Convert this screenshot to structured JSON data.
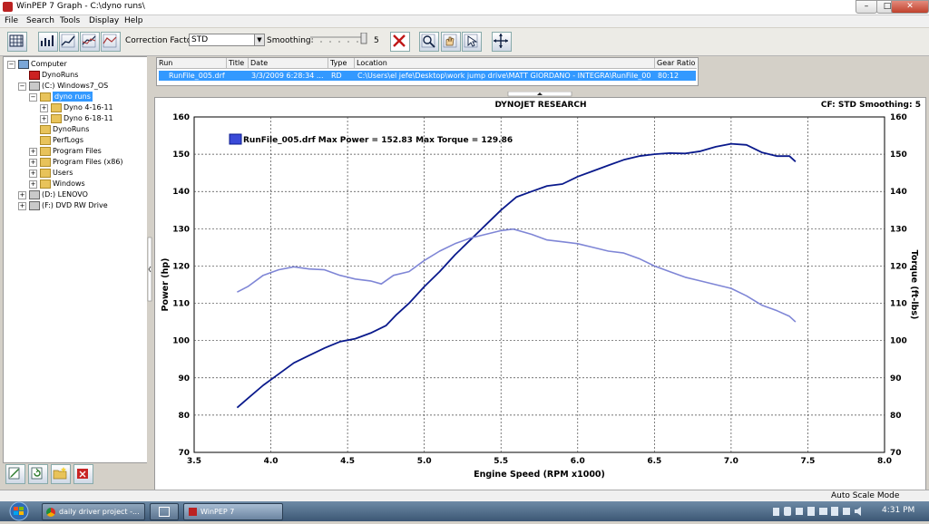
{
  "window": {
    "title": "WinPEP 7     Graph - C:\\dyno runs\\",
    "minimize": "–",
    "maximize": "□",
    "close": "✕"
  },
  "menu": [
    "File",
    "Search",
    "Tools",
    "Display",
    "Help"
  ],
  "toolbar": {
    "correction_factor_label": "Correction Factor:",
    "correction_factor_value": "STD",
    "smoothing_label": "Smoothing:",
    "smoothing_value": "5"
  },
  "tree": [
    {
      "label": "Computer",
      "level": 0,
      "icon": "computer-icon",
      "expander": "minus"
    },
    {
      "label": "DynoRuns",
      "level": 1,
      "icon": "dyno-icon",
      "expander": ""
    },
    {
      "label": "(C:) Windows7_OS",
      "level": 1,
      "icon": "drive-icon",
      "expander": "minus"
    },
    {
      "label": "dyno runs",
      "level": 2,
      "icon": "folder-open-icon",
      "expander": "minus",
      "selected": true
    },
    {
      "label": "Dyno 4-16-11",
      "level": 3,
      "icon": "folder-icon",
      "expander": "plus"
    },
    {
      "label": "Dyno 6-18-11",
      "level": 3,
      "icon": "folder-icon",
      "expander": "plus"
    },
    {
      "label": "DynoRuns",
      "level": 2,
      "icon": "folder-icon",
      "expander": ""
    },
    {
      "label": "PerfLogs",
      "level": 2,
      "icon": "folder-icon",
      "expander": ""
    },
    {
      "label": "Program Files",
      "level": 2,
      "icon": "folder-icon",
      "expander": "plus"
    },
    {
      "label": "Program Files (x86)",
      "level": 2,
      "icon": "folder-icon",
      "expander": "plus"
    },
    {
      "label": "Users",
      "level": 2,
      "icon": "folder-icon",
      "expander": "plus"
    },
    {
      "label": "Windows",
      "level": 2,
      "icon": "folder-icon",
      "expander": "plus"
    },
    {
      "label": "(D:) LENOVO",
      "level": 1,
      "icon": "drive-icon",
      "expander": "plus"
    },
    {
      "label": "(F:) DVD RW Drive",
      "level": 1,
      "icon": "dvd-icon",
      "expander": "plus"
    }
  ],
  "runs_table": {
    "columns": [
      "Run",
      "Title",
      "Date",
      "Type",
      "Location",
      "Gear Ratio"
    ],
    "rows": [
      [
        "RunFile_005.drf",
        "",
        "3/3/2009 6:28:34 ...",
        "RD",
        "C:\\Users\\el jefe\\Desktop\\work jump drive\\MATT GIORDANO - INTEGRA\\RunFile_005....",
        "80:12"
      ]
    ]
  },
  "graph": {
    "header_center": "DYNOJET RESEARCH",
    "header_right": "CF: STD  Smoothing: 5",
    "legend_text": "RunFile_005.drf Max Power = 152.83 Max Torque = 129.86"
  },
  "chart_data": {
    "type": "line",
    "title": "DYNOJET RESEARCH",
    "xlabel": "Engine Speed (RPM x1000)",
    "ylabel": "Power (hp)",
    "y2label": "Torque (ft-lbs)",
    "xlim": [
      3.5,
      8.0
    ],
    "ylim": [
      70,
      160
    ],
    "y2lim": [
      70,
      160
    ],
    "xticks": [
      "3.5",
      "4.0",
      "4.5",
      "5.0",
      "5.5",
      "6.0",
      "6.5",
      "7.0",
      "7.5",
      "8.0"
    ],
    "yticks": [
      "70",
      "80",
      "90",
      "100",
      "110",
      "120",
      "130",
      "140",
      "150",
      "160"
    ],
    "grid": true,
    "legend_position": "top-left",
    "series": [
      {
        "color": "#0a1a8c",
        "points": [
          [
            3.78,
            82
          ],
          [
            3.85,
            84.5
          ],
          [
            3.95,
            88
          ],
          [
            4.05,
            91
          ],
          [
            4.15,
            94
          ],
          [
            4.25,
            96
          ],
          [
            4.35,
            98
          ],
          [
            4.45,
            99.7
          ],
          [
            4.55,
            100.5
          ],
          [
            4.65,
            102
          ],
          [
            4.75,
            104
          ],
          [
            4.82,
            107
          ],
          [
            4.9,
            110
          ],
          [
            5.0,
            114.5
          ],
          [
            5.1,
            118.5
          ],
          [
            5.2,
            123
          ],
          [
            5.3,
            127
          ],
          [
            5.4,
            131
          ],
          [
            5.5,
            135
          ],
          [
            5.6,
            138.5
          ],
          [
            5.7,
            140
          ],
          [
            5.8,
            141.5
          ],
          [
            5.9,
            142
          ],
          [
            6.0,
            144
          ],
          [
            6.1,
            145.5
          ],
          [
            6.2,
            147
          ],
          [
            6.3,
            148.5
          ],
          [
            6.4,
            149.5
          ],
          [
            6.5,
            150
          ],
          [
            6.6,
            150.3
          ],
          [
            6.7,
            150.2
          ],
          [
            6.8,
            150.8
          ],
          [
            6.9,
            152
          ],
          [
            7.0,
            152.8
          ],
          [
            7.1,
            152.5
          ],
          [
            7.2,
            150.5
          ],
          [
            7.3,
            149.5
          ],
          [
            7.38,
            149.5
          ],
          [
            7.42,
            148
          ]
        ]
      },
      {
        "color": "#7f86d6",
        "points": [
          [
            3.78,
            113
          ],
          [
            3.85,
            114.5
          ],
          [
            3.95,
            117.5
          ],
          [
            4.05,
            119
          ],
          [
            4.15,
            119.8
          ],
          [
            4.25,
            119.2
          ],
          [
            4.35,
            119
          ],
          [
            4.45,
            117.5
          ],
          [
            4.55,
            116.5
          ],
          [
            4.65,
            116
          ],
          [
            4.72,
            115.2
          ],
          [
            4.8,
            117.5
          ],
          [
            4.9,
            118.5
          ],
          [
            5.0,
            121.5
          ],
          [
            5.1,
            124
          ],
          [
            5.2,
            126
          ],
          [
            5.3,
            127.5
          ],
          [
            5.4,
            128.5
          ],
          [
            5.5,
            129.5
          ],
          [
            5.58,
            129.9
          ],
          [
            5.7,
            128.5
          ],
          [
            5.8,
            127
          ],
          [
            5.9,
            126.5
          ],
          [
            6.0,
            126
          ],
          [
            6.1,
            125
          ],
          [
            6.2,
            124
          ],
          [
            6.3,
            123.5
          ],
          [
            6.4,
            122
          ],
          [
            6.5,
            120
          ],
          [
            6.6,
            118.5
          ],
          [
            6.7,
            117
          ],
          [
            6.8,
            116
          ],
          [
            6.9,
            115
          ],
          [
            7.0,
            114
          ],
          [
            7.1,
            112
          ],
          [
            7.2,
            109.5
          ],
          [
            7.3,
            108
          ],
          [
            7.38,
            106.5
          ],
          [
            7.42,
            105
          ]
        ]
      }
    ]
  },
  "statusbar": {
    "text": "Auto Scale Mode"
  },
  "taskbar": {
    "start": "Start",
    "tasks": [
      "daily driver project -...",
      "",
      "WinPEP 7"
    ],
    "clock": "4:31 PM"
  }
}
